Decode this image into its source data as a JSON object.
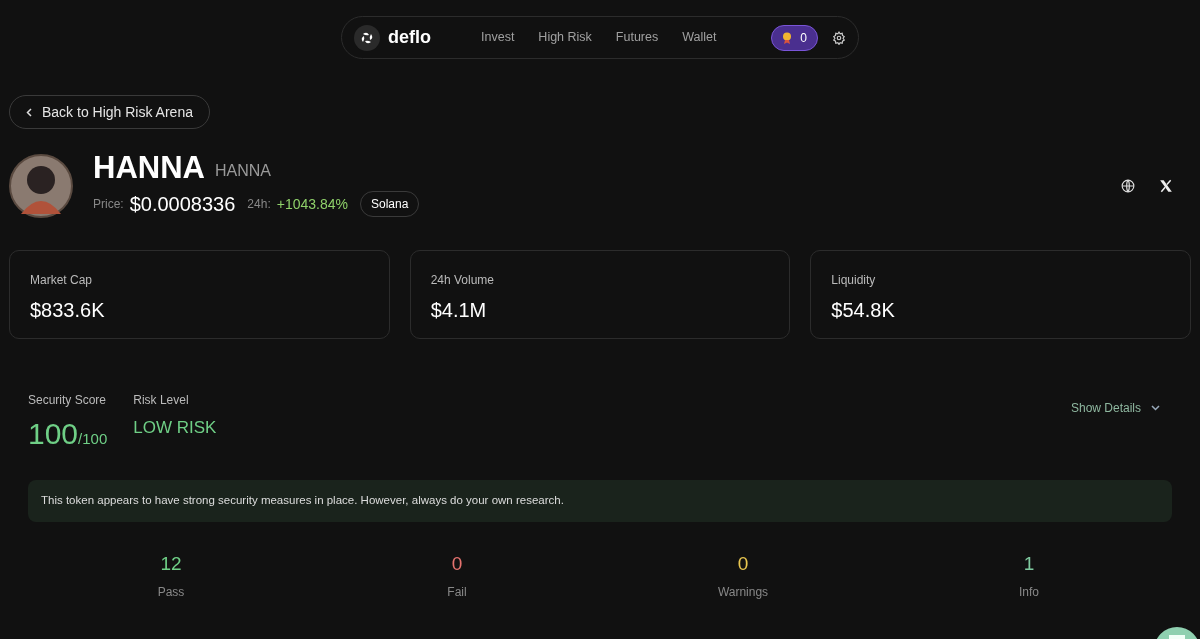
{
  "nav": {
    "brand": "deflo",
    "links": [
      "Invest",
      "High Risk",
      "Futures",
      "Wallet"
    ],
    "points": "0"
  },
  "back_button": "Back to High Risk Arena",
  "token": {
    "name": "HANNA",
    "symbol": "HANNA",
    "price_label": "Price:",
    "price": "$0.0008336",
    "change_label": "24h:",
    "change": "+1043.84%",
    "chain": "Solana"
  },
  "metrics": [
    {
      "label": "Market Cap",
      "value": "$833.6K"
    },
    {
      "label": "24h Volume",
      "value": "$4.1M"
    },
    {
      "label": "Liquidity",
      "value": "$54.8K"
    }
  ],
  "security": {
    "score_label": "Security Score",
    "score": "100",
    "score_max": "/100",
    "risk_label": "Risk Level",
    "risk": "LOW RISK",
    "details_toggle": "Show Details",
    "expanded": false,
    "message": "This token appears to have strong security measures in place. However, always do your own research."
  },
  "checks": [
    {
      "count": "12",
      "label": "Pass",
      "color": "#6fcf86"
    },
    {
      "count": "0",
      "label": "Fail",
      "color": "#e5736f"
    },
    {
      "count": "0",
      "label": "Warnings",
      "color": "#e8c650"
    },
    {
      "count": "1",
      "label": "Info",
      "color": "#7fcaa0"
    }
  ]
}
